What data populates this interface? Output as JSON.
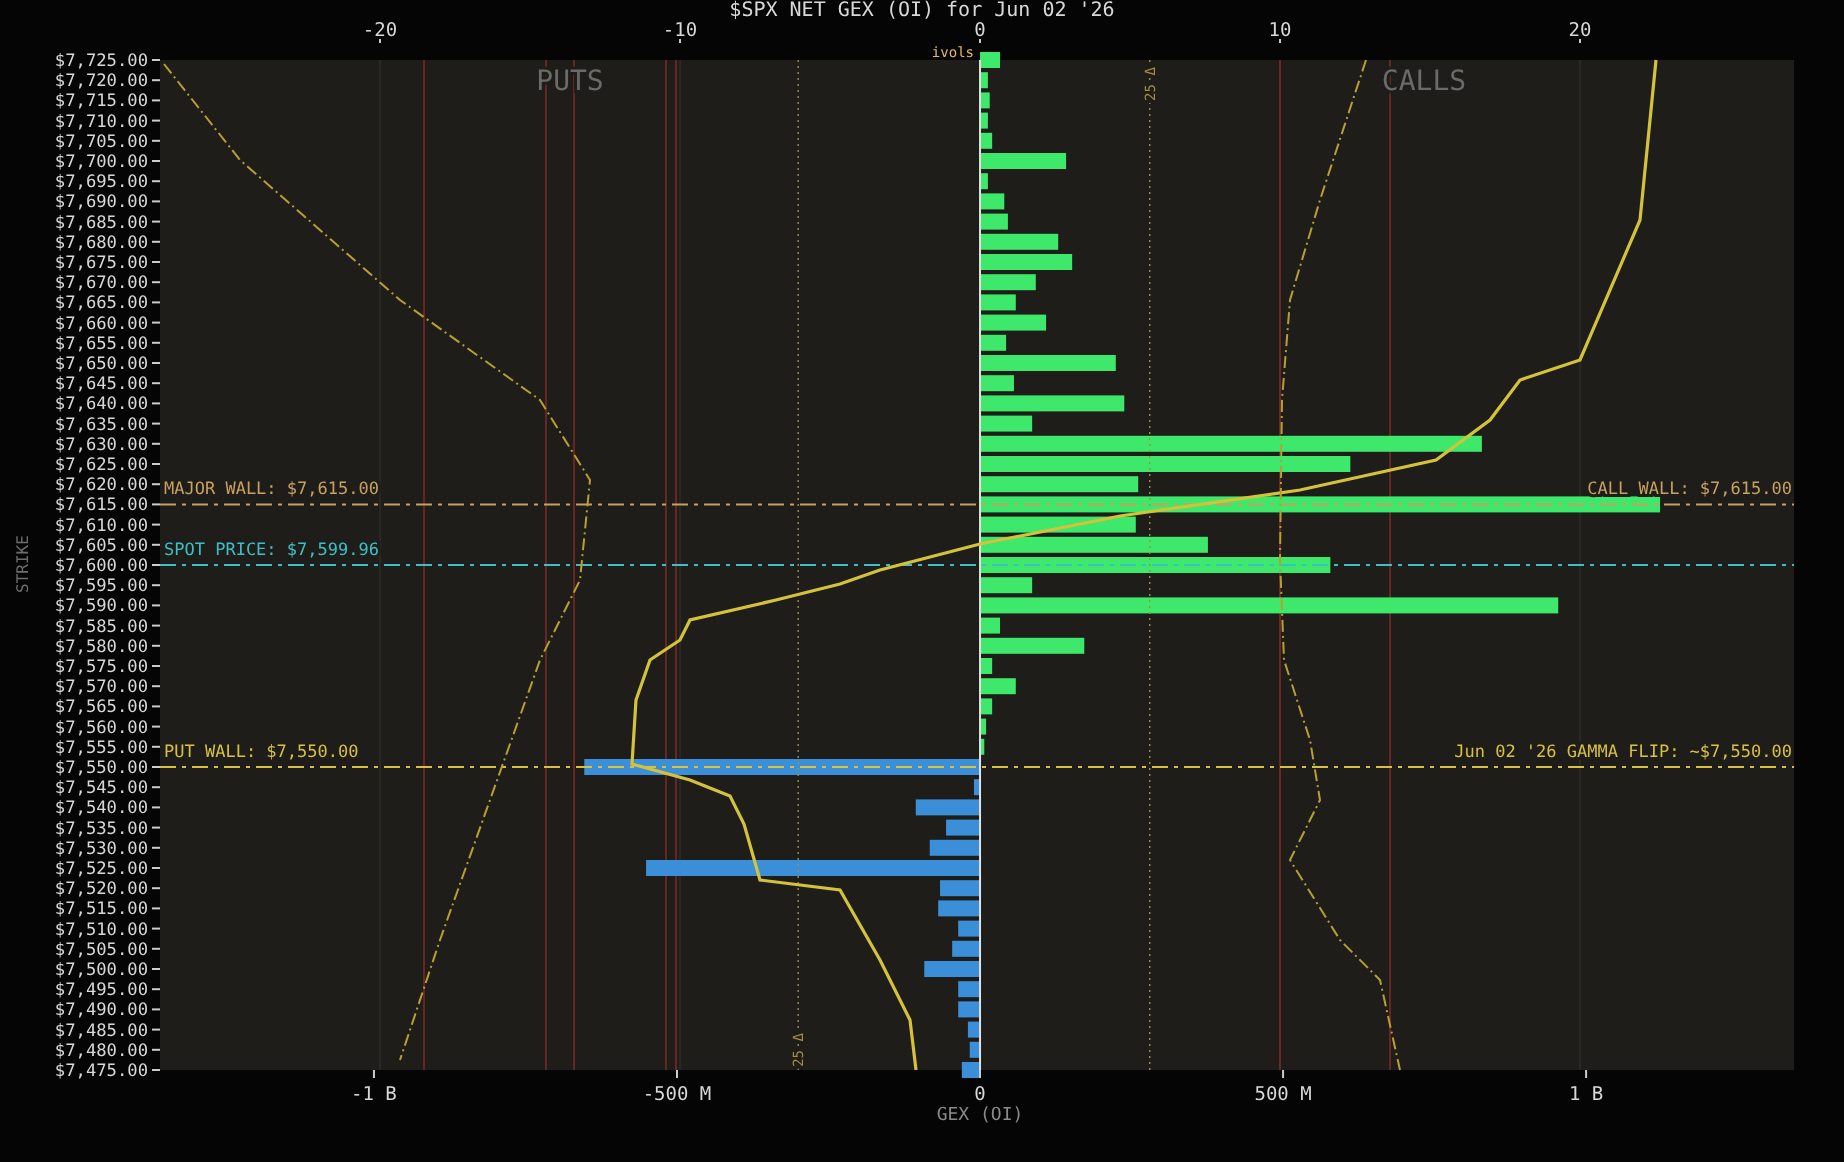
{
  "chart": {
    "chart_data": {
      "type": "bar",
      "orientation": "horizontal",
      "title": "$SPX NET GEX (OI) for Jun 02 '26",
      "xlabel": "GEX (OI)",
      "ylabel": "STRIKE",
      "grid": true,
      "categories": [
        "$7,725.00",
        "$7,720.00",
        "$7,715.00",
        "$7,710.00",
        "$7,705.00",
        "$7,700.00",
        "$7,695.00",
        "$7,690.00",
        "$7,685.00",
        "$7,680.00",
        "$7,675.00",
        "$7,670.00",
        "$7,665.00",
        "$7,660.00",
        "$7,655.00",
        "$7,650.00",
        "$7,645.00",
        "$7,640.00",
        "$7,635.00",
        "$7,630.00",
        "$7,625.00",
        "$7,620.00",
        "$7,615.00",
        "$7,610.00",
        "$7,605.00",
        "$7,600.00",
        "$7,595.00",
        "$7,590.00",
        "$7,585.00",
        "$7,580.00",
        "$7,575.00",
        "$7,570.00",
        "$7,565.00",
        "$7,560.00",
        "$7,555.00",
        "$7,550.00",
        "$7,545.00",
        "$7,540.00",
        "$7,535.00",
        "$7,530.00",
        "$7,525.00",
        "$7,520.00",
        "$7,515.00",
        "$7,510.00",
        "$7,505.00",
        "$7,500.00",
        "$7,495.00",
        "$7,490.00",
        "$7,485.00",
        "$7,480.00",
        "$7,475.00"
      ],
      "series": [
        {
          "color": "#3ee86a",
          "values": [
            33000000,
            13000000,
            16000000,
            13000000,
            20000000,
            142000000,
            13000000,
            40000000,
            46000000,
            129000000,
            152000000,
            92000000,
            59000000,
            109000000,
            43000000,
            224000000,
            56000000,
            238000000,
            86000000,
            828000000,
            611000000,
            261000000,
            1122000000,
            257000000,
            376000000,
            578000000,
            86000000,
            954000000,
            33000000,
            172000000,
            20000000,
            59000000,
            20000000,
            10000000,
            7000000,
            null,
            null,
            null,
            null,
            null,
            null,
            null,
            null,
            null,
            null,
            null,
            null,
            null,
            null,
            null,
            null
          ]
        },
        {
          "color": "#3a8fd8",
          "values": [
            null,
            null,
            null,
            null,
            null,
            null,
            null,
            null,
            null,
            null,
            null,
            null,
            null,
            null,
            null,
            null,
            null,
            null,
            null,
            null,
            null,
            null,
            null,
            null,
            null,
            null,
            null,
            null,
            null,
            null,
            null,
            null,
            null,
            null,
            null,
            -653000000,
            -10000000,
            -106000000,
            -56000000,
            -83000000,
            -551000000,
            -66000000,
            -69000000,
            -36000000,
            -46000000,
            -92000000,
            -36000000,
            -36000000,
            -20000000,
            -17000000,
            -30000000
          ]
        }
      ],
      "xlim": [
        -1353000000,
        1343000000
      ],
      "xticks": [
        {
          "value": -1000000000,
          "label": "-1 B"
        },
        {
          "value": -500000000,
          "label": "-500 M"
        },
        {
          "value": 0,
          "label": "0"
        },
        {
          "value": 500000000,
          "label": "500 M"
        },
        {
          "value": 1000000000,
          "label": "1 B"
        }
      ],
      "ref_lines": [
        {
          "axis": "y",
          "value": "$7,615.00",
          "label": "MAJOR WALL: $7,615.00",
          "color": "#c8a060"
        },
        {
          "axis": "y",
          "value": "$7,600.00",
          "label": "SPOT PRICE: $7,599.96",
          "color": "#3cc0c8"
        },
        {
          "axis": "y",
          "value": "$7,550.00",
          "label": "PUT WALL: $7,550.00",
          "color": "#d8c040"
        },
        {
          "axis": "x",
          "value": 280000000,
          "label": "25 Δ",
          "color": "#a09040"
        },
        {
          "axis": "x",
          "value": -300000000,
          "label": "25 Δ",
          "color": "#a09040"
        }
      ]
    },
    "right_labels": [
      "CALL WALL: $7,615.00",
      "Jun 02 '26 GAMMA FLIP: ~$7,550.00"
    ],
    "top_ticks": [
      "-20",
      "-10",
      "0",
      "10",
      "20"
    ],
    "top_marker": "ivols",
    "side_labels": [
      "PUTS",
      "CALLS"
    ]
  }
}
